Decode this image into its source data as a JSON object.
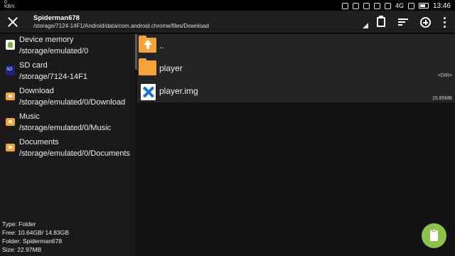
{
  "status_bar": {
    "left_top": "0",
    "left_bottom": "KB/s",
    "network": "4G",
    "clock": "13:46"
  },
  "toolbar": {
    "title": "Spiderman678",
    "path": "/storage/7124-14F1/Android/data/com.android.chrome/files/Download"
  },
  "sidebar": {
    "items": [
      {
        "name": "Device memory",
        "path": "/storage/emulated/0",
        "icon": "android-icon"
      },
      {
        "name": "SD card",
        "path": "/storage/7124-14F1",
        "icon": "sd-card-icon"
      },
      {
        "name": "Download",
        "path": "/storage/emulated/0/Download",
        "icon": "folder-icon"
      },
      {
        "name": "Music",
        "path": "/storage/emulated/0/Music",
        "icon": "folder-icon"
      },
      {
        "name": "Documents",
        "path": "/storage/emulated/0/Documents",
        "icon": "folder-icon"
      }
    ],
    "info": {
      "type": "Type: Folder",
      "free": "Free: 10.64GB/ 14.83GB",
      "folder": "Folder: Spiderman678",
      "size": "Size: 22.97MB"
    }
  },
  "files": [
    {
      "name": "..",
      "meta": "",
      "icon": "folder-up-icon"
    },
    {
      "name": "player",
      "meta": "<DIR>",
      "icon": "folder-icon"
    },
    {
      "name": "player.img",
      "meta": "15.85MB",
      "icon": "image-file-icon"
    }
  ],
  "colors": {
    "folder": "#f5a43a",
    "fab": "#8bc34a",
    "background": "#121212"
  }
}
